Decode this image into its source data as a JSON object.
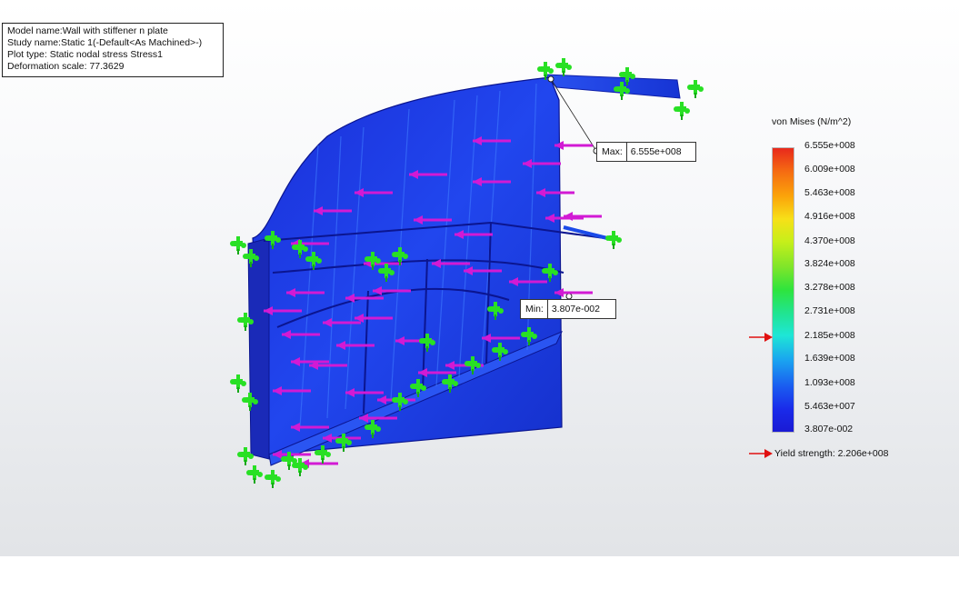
{
  "info": {
    "model_name": "Model name:Wall with stiffener n plate",
    "study_name": "Study name:Static 1(-Default<As Machined>-)",
    "plot_type": "Plot type: Static nodal stress Stress1",
    "deformation_scale": "Deformation scale: 77.3629"
  },
  "probes": {
    "max": {
      "label": "Max:",
      "value": "6.555e+008"
    },
    "min": {
      "label": "Min:",
      "value": "3.807e-002"
    }
  },
  "legend": {
    "title": "von Mises (N/m^2)",
    "ticks": [
      "6.555e+008",
      "6.009e+008",
      "5.463e+008",
      "4.916e+008",
      "4.370e+008",
      "3.824e+008",
      "3.278e+008",
      "2.731e+008",
      "2.185e+008",
      "1.639e+008",
      "1.093e+008",
      "5.463e+007",
      "3.807e-002"
    ],
    "yield_label": "Yield strength: 2.206e+008",
    "colors": {
      "high": "#e8291c",
      "low": "#1a1ad4",
      "marker": "#e01010"
    }
  },
  "model": {
    "fixture_icon": "fixture-green-icon",
    "load_icon": "force-arrow-magenta-icon",
    "colors": {
      "body": "#1b3fe0",
      "fixture": "#28e024",
      "load": "#d21ad4"
    }
  }
}
